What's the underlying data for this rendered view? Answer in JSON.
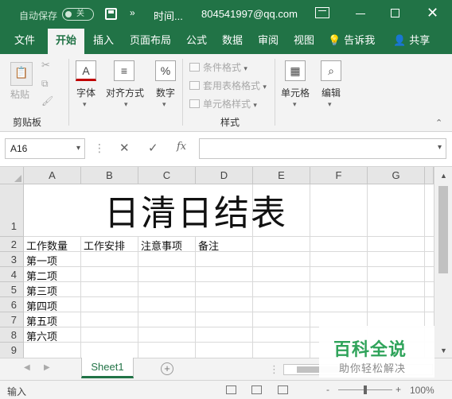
{
  "titlebar": {
    "autosave_label": "自动保存",
    "autosave_state": "关",
    "more_glyph": "»",
    "doc_title": "时间...",
    "account": "804541997@qq.com",
    "close_glyph": "✕"
  },
  "tabs": [
    {
      "label": "文件"
    },
    {
      "label": "开始"
    },
    {
      "label": "插入"
    },
    {
      "label": "页面布局"
    },
    {
      "label": "公式"
    },
    {
      "label": "数据"
    },
    {
      "label": "审阅"
    },
    {
      "label": "视图"
    },
    {
      "label": "告诉我"
    },
    {
      "label": "共享"
    }
  ],
  "active_tab": "开始",
  "ribbon": {
    "clipboard": {
      "paste": "粘贴",
      "group": "剪贴板"
    },
    "font": {
      "label": "字体",
      "icon_text": "A"
    },
    "align": {
      "label": "对齐方式"
    },
    "number": {
      "label": "数字",
      "icon_text": "%"
    },
    "styles": {
      "cond_format": "条件格式",
      "table_format": "套用表格格式",
      "cell_style": "单元格样式",
      "group": "样式"
    },
    "cells": {
      "label": "单元格"
    },
    "editing": {
      "label": "编辑"
    }
  },
  "formula_bar": {
    "name_box": "A16",
    "cancel_glyph": "✕",
    "enter_glyph": "✓",
    "fx_glyph": "fx",
    "formula_value": ""
  },
  "grid": {
    "columns": [
      "A",
      "B",
      "C",
      "D",
      "E",
      "F",
      "G"
    ],
    "rows": [
      "1",
      "2",
      "3",
      "4",
      "5",
      "6",
      "7",
      "8",
      "9"
    ],
    "title": "日清日结表",
    "headers": [
      "工作数量",
      "工作安排",
      "注意事项",
      "备注"
    ],
    "items": [
      "第一项",
      "第二项",
      "第三项",
      "第四项",
      "第五项",
      "第六项"
    ]
  },
  "sheets": [
    {
      "name": "Sheet1"
    }
  ],
  "add_sheet_glyph": "+",
  "status": {
    "mode": "输入",
    "zoom": "100%",
    "zoom_minus": "-",
    "zoom_plus": "+"
  },
  "watermark": {
    "main": "百科全说",
    "sub": "助你轻松解决"
  },
  "colors": {
    "brand": "#217346",
    "watermark": "#2fa35a"
  }
}
